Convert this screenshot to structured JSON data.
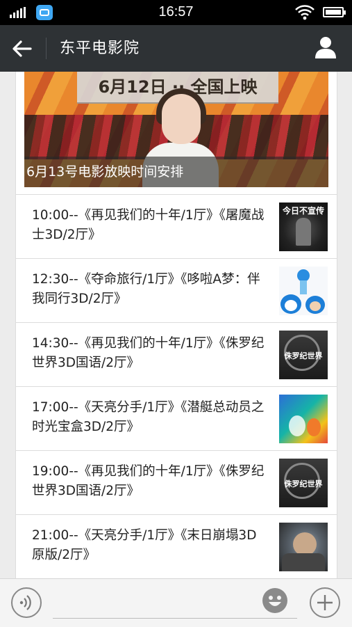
{
  "status_bar": {
    "time": "16:57",
    "icons": [
      "signal-icon",
      "app-notification-icon",
      "wifi-icon",
      "battery-icon"
    ]
  },
  "header": {
    "title": "东平电影院",
    "back_icon": "arrow-left-icon",
    "profile_icon": "person-icon"
  },
  "banner": {
    "caption": "6月13号电影放映时间安排",
    "board_text": "6月12日 ·· 全国上映"
  },
  "schedule": [
    {
      "text": "10:00--《再见我们的十年/1厅》《屠魔战士3D/2厅》",
      "poster_caption": "今日不宣传"
    },
    {
      "text": "12:30--《夺命旅行/1厅》《哆啦A梦：伴我同行3D/2厅》",
      "poster_caption": ""
    },
    {
      "text": "14:30--《再见我们的十年/1厅》《侏罗纪世界3D国语/2厅》",
      "poster_caption": "侏罗纪世界"
    },
    {
      "text": "17:00--《天亮分手/1厅》《潜艇总动员之时光宝盒3D/2厅》",
      "poster_caption": ""
    },
    {
      "text": "19:00--《再见我们的十年/1厅》《侏罗纪世界3D国语/2厅》",
      "poster_caption": "侏罗纪世界"
    },
    {
      "text": "21:00--《天亮分手/1厅》《末日崩塌3D原版/2厅》",
      "poster_caption": ""
    }
  ],
  "input_bar": {
    "voice_icon": "voice-icon",
    "emoji_icon": "emoji-icon",
    "plus_icon": "plus-icon"
  }
}
